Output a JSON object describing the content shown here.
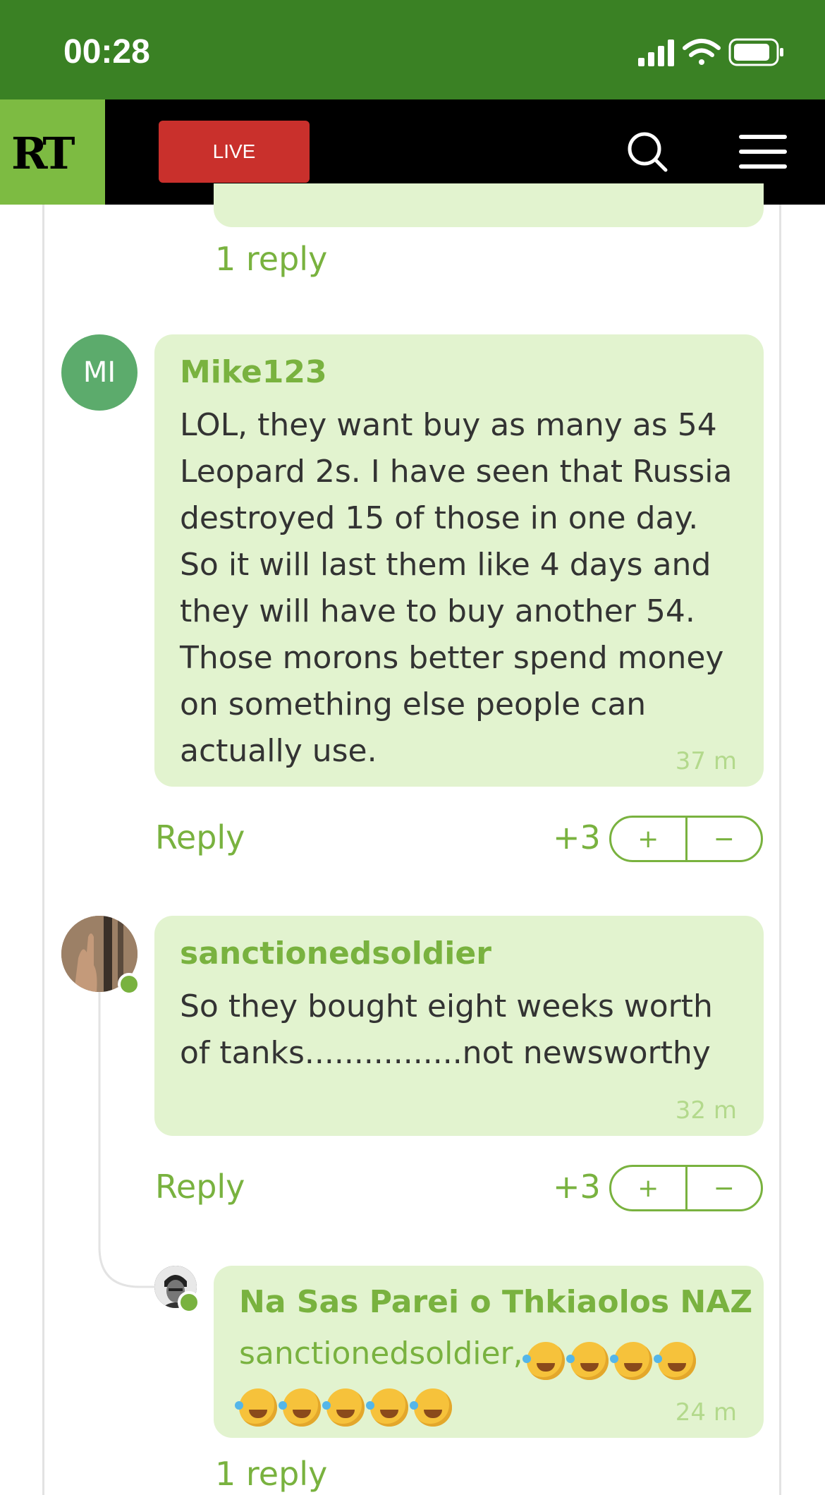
{
  "status_bar": {
    "time": "00:28"
  },
  "navbar": {
    "logo": "RT",
    "live_label": "LIVE"
  },
  "thread": {
    "top_reply_link": "1 reply",
    "comments": [
      {
        "avatar_initials": "MI",
        "author": "Mike123",
        "text": "LOL, they want buy as many as 54 Leopard 2s. I have seen that Russia destroyed 15 of those in one day. So it will last them like 4 days and they will have to buy another 54. Those morons better spend money on something else people can actually use.",
        "time": "37 m",
        "reply_label": "Reply",
        "score": "+3",
        "plus": "+",
        "minus": "−"
      },
      {
        "author": "sanctionedsoldier",
        "text": "So they bought eight weeks worth of tanks................not newsworthy",
        "time": "32 m",
        "reply_label": "Reply",
        "score": "+3",
        "plus": "+",
        "minus": "−"
      },
      {
        "author": "Na Sas Parei o Thkiaolos NAZ",
        "mention": "sanctionedsoldier,",
        "emoji_count": 9,
        "emoji_name": "rolling-on-floor-laughing",
        "time": "24 m",
        "reply_link": "1 reply"
      }
    ]
  },
  "colors": {
    "status_green": "#3a8124",
    "accent_green": "#79b23f",
    "bubble_bg": "#e2f3cf",
    "live_red": "#c9302c"
  }
}
